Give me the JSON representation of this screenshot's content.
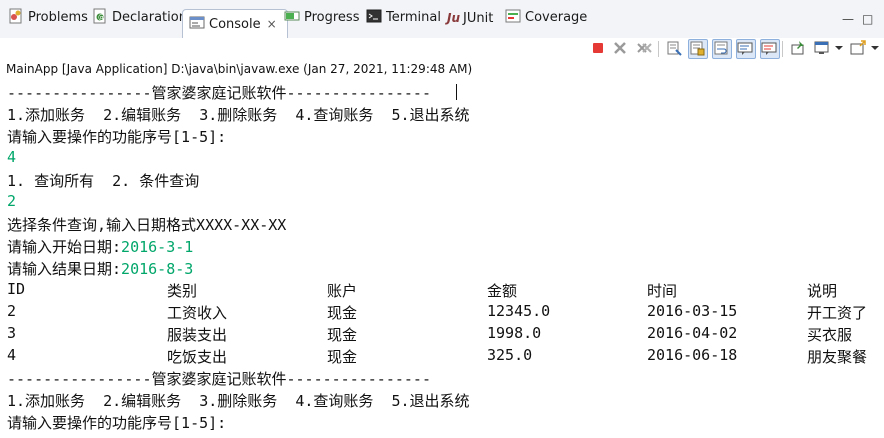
{
  "tabs": [
    {
      "label": "Problems",
      "icon": "problems-icon"
    },
    {
      "label": "Declaration",
      "icon": "declaration-icon"
    },
    {
      "label": "Console",
      "icon": "console-icon",
      "active": true,
      "close": "×"
    },
    {
      "label": "Progress",
      "icon": "progress-icon"
    },
    {
      "label": "Terminal",
      "icon": "terminal-icon"
    },
    {
      "label": "JUnit",
      "icon": "junit-icon",
      "prefix": "Ju"
    },
    {
      "label": "Coverage",
      "icon": "coverage-icon"
    }
  ],
  "window_controls": {
    "minimize": "—",
    "maximize": "□"
  },
  "toolbar": {
    "icons": [
      "terminate-icon",
      "remove-launch-icon",
      "remove-all-terminated-icon",
      "clear-console-icon",
      "scroll-lock-icon",
      "word-wrap-icon",
      "show-on-stdout-icon",
      "show-on-stderr-icon",
      "pin-console-icon",
      "display-console-icon",
      "open-console-icon"
    ]
  },
  "status_text": "MainApp [Java Application] D:\\java\\bin\\javaw.exe (Jan 27, 2021, 11:29:48 AM)",
  "colors": {
    "input_text": "#00a66a",
    "terminate": "#e53935"
  },
  "console": {
    "lines": [
      {
        "text": "----------------管家婆家庭记账软件----------------",
        "type": "output"
      },
      {
        "text": "1.添加账务  2.编辑账务  3.删除账务  4.查询账务  5.退出系统",
        "type": "output"
      },
      {
        "text": "请输入要操作的功能序号[1-5]:",
        "type": "output"
      },
      {
        "text": "4",
        "type": "input"
      },
      {
        "text": "1. 查询所有  2. 条件查询",
        "type": "output"
      },
      {
        "text": "2",
        "type": "input"
      },
      {
        "text": "选择条件查询,输入日期格式XXXX-XX-XX",
        "type": "output"
      }
    ],
    "start_date_prompt": "请输入开始日期:",
    "start_date_value": "2016-3-1",
    "end_date_prompt": "请输入结果日期:",
    "end_date_value": "2016-8-3",
    "table": {
      "headers": [
        "ID",
        "类别",
        "账户",
        "金额",
        "时间",
        "说明"
      ],
      "rows": [
        [
          "2",
          "工资收入",
          "现金",
          "12345.0",
          "2016-03-15",
          "开工资了"
        ],
        [
          "3",
          "服装支出",
          "现金",
          "1998.0",
          "2016-04-02",
          "买衣服"
        ],
        [
          "4",
          "吃饭支出",
          "现金",
          "325.0",
          "2016-06-18",
          "朋友聚餐"
        ]
      ]
    },
    "footer_lines": [
      "----------------管家婆家庭记账软件----------------",
      "1.添加账务  2.编辑账务  3.删除账务  4.查询账务  5.退出系统",
      "请输入要操作的功能序号[1-5]:"
    ]
  }
}
